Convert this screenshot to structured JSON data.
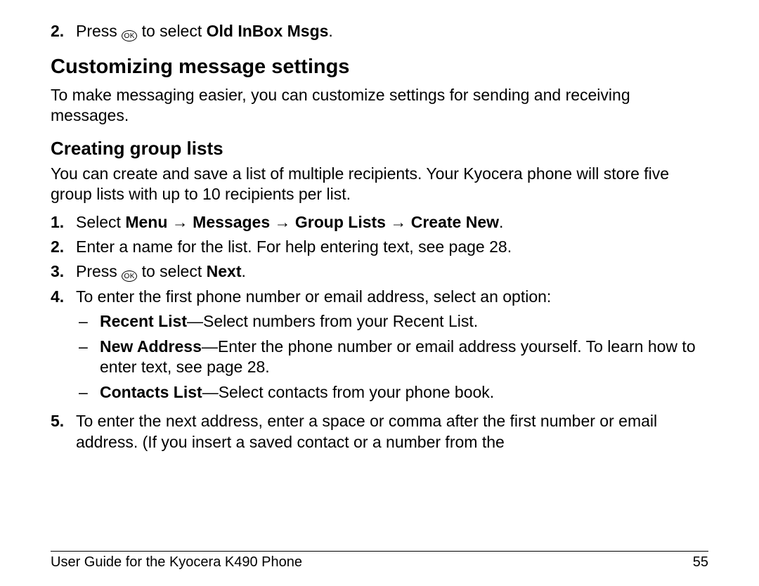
{
  "topStep": {
    "num": "2.",
    "pre": "Press ",
    "iconLabel": "OK",
    "mid": " to select ",
    "bold": "Old InBox Msgs",
    "post": "."
  },
  "h1": "Customizing message settings",
  "introPara": "To make messaging easier, you can customize settings for sending and receiving messages.",
  "h2": "Creating group lists",
  "groupIntro": "You can create and save a list of multiple recipients. Your Kyocera phone will store five group lists with up to 10 recipients per list.",
  "steps": {
    "s1": {
      "num": "1.",
      "pre": "Select ",
      "boldPath": "Menu → Messages → Group Lists → Create New",
      "post": "."
    },
    "s2": {
      "num": "2.",
      "text": "Enter a name for the list. For help entering text, see page 28."
    },
    "s3": {
      "num": "3.",
      "pre": "Press ",
      "iconLabel": "OK",
      "mid": " to select ",
      "bold": "Next",
      "post": "."
    },
    "s4": {
      "num": "4.",
      "text": "To enter the first phone number or email address, select an option:",
      "sub": {
        "a": {
          "bold": "Recent List",
          "rest": "—Select numbers from your Recent List."
        },
        "b": {
          "bold": "New Address",
          "rest": "—Enter the phone number or email address yourself. To learn how to enter text, see page 28."
        },
        "c": {
          "bold": "Contacts List",
          "rest": "—Select contacts from your phone book."
        }
      }
    },
    "s5": {
      "num": "5.",
      "text": "To enter the next address, enter a space or comma after the first number or email address. (If you insert a saved contact or a number from the"
    }
  },
  "footer": {
    "left": "User Guide for the Kyocera K490 Phone",
    "right": "55"
  }
}
